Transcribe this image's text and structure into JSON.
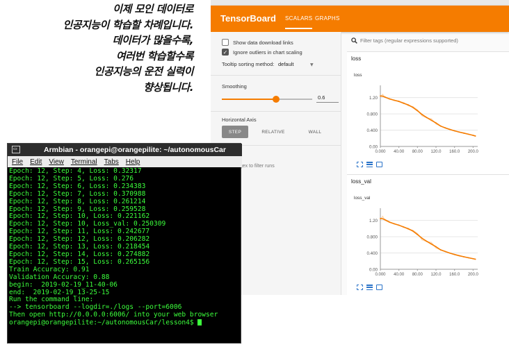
{
  "caption": {
    "lines": [
      "이제 모인 데이터로",
      "인공지능이 학습할 차례입니다.",
      "데이터가 많을수록,",
      "여러번 학습할수록",
      "인공지능의 운전 실력이",
      "향상됩니다."
    ]
  },
  "tensorboard": {
    "brand": "TensorBoard",
    "tabs": [
      "SCALARS",
      "GRAPHS"
    ],
    "active_tab": "SCALARS",
    "accent_color": "#f57c00",
    "sidebar": {
      "show_download_links": "Show data download links",
      "show_download_links_checked": false,
      "ignore_outliers": "Ignore outliers in chart scaling",
      "ignore_outliers_checked": true,
      "tooltip_label": "Tooltip sorting method:",
      "tooltip_value": "default",
      "smoothing_label": "Smoothing",
      "smoothing_value": "0.6",
      "smoothing_fraction": 0.6,
      "horizontal_axis_label": "Horizontal Axis",
      "axis_options": [
        "STEP",
        "RELATIVE",
        "WALL"
      ],
      "axis_active": "STEP",
      "runs_filter_placeholder": "egex to filter runs"
    },
    "filter_tags_placeholder": "Filter tags (regular expressions supported)",
    "sections": [
      {
        "title": "loss",
        "chart_title": "loss"
      },
      {
        "title": "loss_val",
        "chart_title": "loss_val"
      }
    ]
  },
  "chart_data": [
    {
      "type": "line",
      "title": "loss",
      "x_ticks": [
        "0.000",
        "40.00",
        "80.00",
        "120.0",
        "160.0",
        "200.0"
      ],
      "y_ticks": [
        "0.00",
        "0.400",
        "0.800",
        "1.20"
      ],
      "xlim": [
        0,
        210
      ],
      "ylim": [
        0,
        1.5
      ],
      "color": "#f57c00",
      "series": [
        {
          "x": [
            0,
            5,
            10,
            20,
            30,
            40,
            50,
            60,
            70,
            80,
            90,
            100,
            110,
            120,
            130,
            140,
            150,
            160,
            170,
            180,
            190,
            200,
            205
          ],
          "y": [
            1.22,
            1.28,
            1.2,
            1.16,
            1.14,
            1.1,
            1.08,
            1.0,
            0.98,
            0.9,
            0.75,
            0.7,
            0.68,
            0.55,
            0.5,
            0.45,
            0.42,
            0.38,
            0.35,
            0.33,
            0.3,
            0.27,
            0.25
          ]
        }
      ]
    },
    {
      "type": "line",
      "title": "loss_val",
      "x_ticks": [
        "0.000",
        "40.00",
        "80.00",
        "120.0",
        "160.0",
        "200.0"
      ],
      "y_ticks": [
        "0.00",
        "0.400",
        "0.800",
        "1.20"
      ],
      "xlim": [
        0,
        210
      ],
      "ylim": [
        0,
        1.5
      ],
      "color": "#f57c00",
      "series": [
        {
          "x": [
            0,
            5,
            10,
            20,
            30,
            40,
            50,
            60,
            70,
            80,
            90,
            100,
            110,
            120,
            130,
            140,
            150,
            160,
            170,
            180,
            190,
            200,
            205
          ],
          "y": [
            1.22,
            1.3,
            1.2,
            1.15,
            1.12,
            1.08,
            1.05,
            0.98,
            0.96,
            0.88,
            0.72,
            0.68,
            0.66,
            0.52,
            0.48,
            0.43,
            0.4,
            0.36,
            0.33,
            0.31,
            0.28,
            0.26,
            0.24
          ]
        }
      ]
    }
  ],
  "terminal": {
    "title": "Armbian - orangepi@orangepilite: ~/autonomousCar",
    "menu": [
      "File",
      "Edit",
      "View",
      "Terminal",
      "Tabs",
      "Help"
    ],
    "text_color": "#3cff3c",
    "lines": [
      "Epoch: 12, Step: 4, Loss: 0.32317",
      "Epoch: 12, Step: 5, Loss: 0.276",
      "Epoch: 12, Step: 6, Loss: 0.234383",
      "Epoch: 12, Step: 7, Loss: 0.370988",
      "Epoch: 12, Step: 8, Loss: 0.261214",
      "Epoch: 12, Step: 9, Loss: 0.259528",
      "Epoch: 12, Step: 10, Loss: 0.221162",
      "Epoch: 12, Step: 10, Loss_val: 0.250309",
      "Epoch: 12, Step: 11, Loss: 0.242677",
      "Epoch: 12, Step: 12, Loss: 0.206282",
      "Epoch: 12, Step: 13, Loss: 0.218454",
      "Epoch: 12, Step: 14, Loss: 0.274882",
      "Epoch: 12, Step: 15, Loss: 0.265156",
      "Train Accuracy: 0.91",
      "Validation Accuracy: 0.88",
      "begin:  2019-02-19_11-40-06",
      "end:  2019-02-19_13-25-15",
      "Run the command line:",
      "--> tensorboard --logdir=./logs --port=6006",
      "Then open http://0.0.0.0:6006/ into your web browser",
      "orangepi@orangepilite:~/autonomousCar/lesson4$ "
    ]
  }
}
